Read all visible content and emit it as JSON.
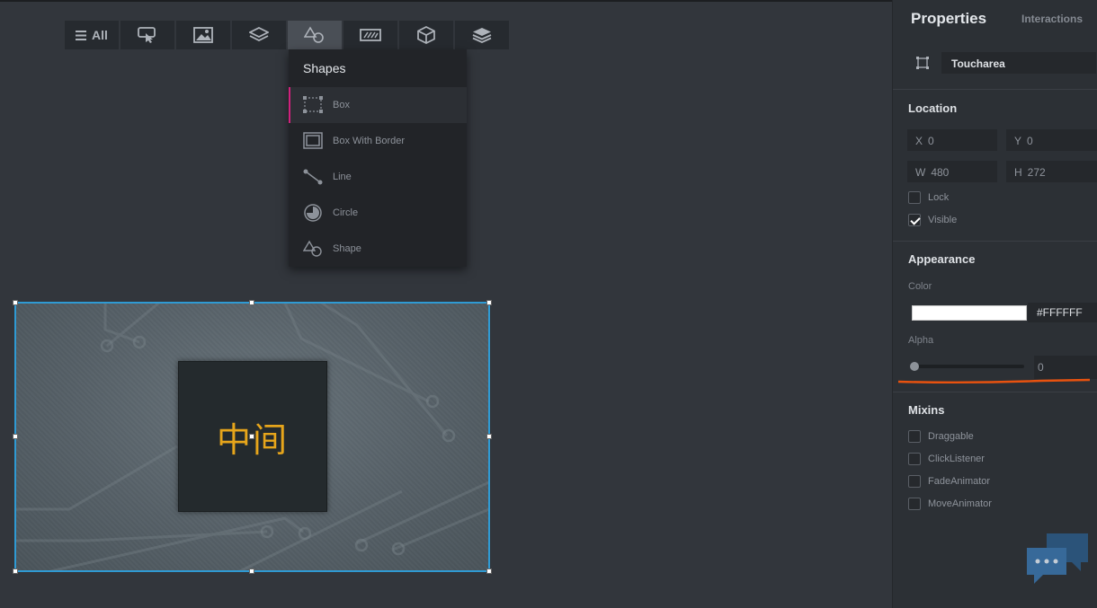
{
  "toolbar": {
    "all_label": "All",
    "buttons": [
      "hand-pointer-icon",
      "image-icon",
      "layers-icon",
      "shapes-icon",
      "textbox-icon",
      "cube-icon",
      "stack-icon"
    ],
    "active": "shapes-icon"
  },
  "dropdown": {
    "title": "Shapes",
    "items": [
      {
        "label": "Box",
        "icon": "box-icon",
        "selected": true
      },
      {
        "label": "Box With Border",
        "icon": "box-border-icon",
        "selected": false
      },
      {
        "label": "Line",
        "icon": "line-icon",
        "selected": false
      },
      {
        "label": "Circle",
        "icon": "circle-icon",
        "selected": false
      },
      {
        "label": "Shape",
        "icon": "shape-icon",
        "selected": false
      }
    ],
    "accent_color": "#d0217c"
  },
  "canvas": {
    "center_text": "中间",
    "selection_color": "#2f9ad3",
    "text_color": "#e6a51b"
  },
  "panel": {
    "title": "Properties",
    "tab2": "Interactions",
    "element_name": "Toucharea",
    "location": {
      "heading": "Location",
      "x_label": "X",
      "x": "0",
      "y_label": "Y",
      "y": "0",
      "w_label": "W",
      "w": "480",
      "h_label": "H",
      "h": "272",
      "lock_label": "Lock",
      "lock": false,
      "visible_label": "Visible",
      "visible": true
    },
    "appearance": {
      "heading": "Appearance",
      "color_label": "Color",
      "color_value": "#FFFFFF",
      "alpha_label": "Alpha",
      "alpha_value": "0"
    },
    "mixins": {
      "heading": "Mixins",
      "items": [
        {
          "label": "Draggable",
          "checked": false
        },
        {
          "label": "ClickListener",
          "checked": false
        },
        {
          "label": "FadeAnimator",
          "checked": false
        },
        {
          "label": "MoveAnimator",
          "checked": false
        }
      ]
    },
    "annotation_color": "#e8520f"
  }
}
